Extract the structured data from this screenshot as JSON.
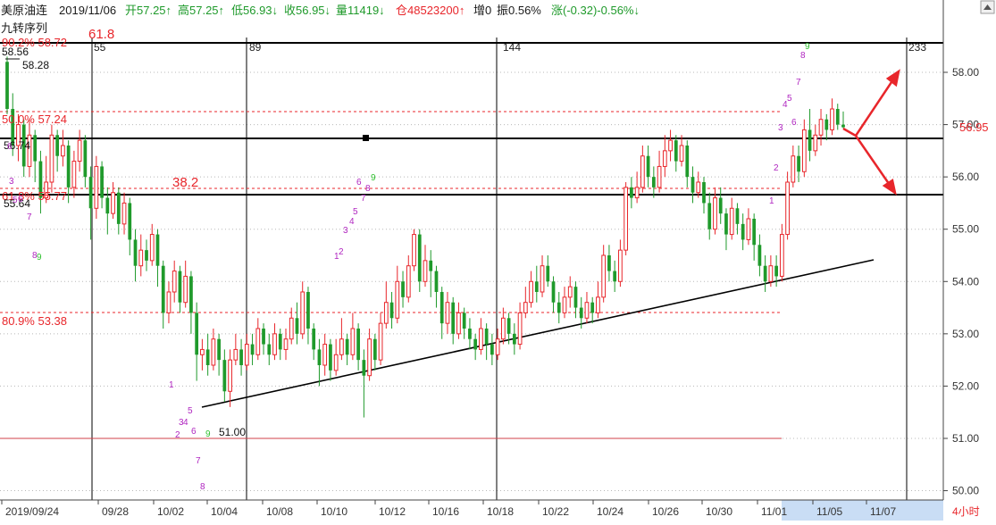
{
  "header": {
    "name": "美原油连",
    "date": "2019/11/06",
    "open_label": "开57.25↑",
    "high_label": "高57.25↑",
    "low_label": "低56.93↓",
    "close_label": "收56.95↓",
    "volume_label": "量11419↓",
    "oi_label": "仓48523200↑",
    "oi_change_label": "增0",
    "amplitude_label": "振0.56%",
    "change_label": "涨(-0.32)-0.56%↓",
    "indicator_name": "九转序列"
  },
  "colors": {
    "up": "#e8262b",
    "down": "#1f9a2b",
    "fib_line": "#e8262b",
    "td_purple": "#b026c0",
    "td_green": "#30c030",
    "time_axis_highlight": "#c9ddf5"
  },
  "price_tag": "56.95",
  "period_label": "4小时",
  "fib_time_labels": [
    "55",
    "89",
    "144",
    "233"
  ],
  "fib_ratio_labels": [
    "61.8",
    "38.2"
  ],
  "fib_levels": [
    {
      "label": "90.2% 58.72",
      "value": 58.72
    },
    {
      "label": "50.0% 57.24",
      "value": 57.24
    },
    {
      "label": "61.8% 55.77",
      "value": 55.77
    },
    {
      "label": "80.9% 53.38",
      "value": 53.38
    }
  ],
  "point_labels": [
    {
      "text": "58.56"
    },
    {
      "text": "58.28"
    },
    {
      "text": "56.74"
    },
    {
      "text": "55.64"
    },
    {
      "text": "51.00"
    }
  ],
  "chart_data": {
    "type": "candlestick",
    "title": "",
    "instrument": "美原油连",
    "interval": "4小时",
    "ylim": [
      49.8,
      58.6
    ],
    "yticks": [
      50.0,
      51.0,
      52.0,
      53.0,
      54.0,
      55.0,
      56.0,
      57.0,
      58.0
    ],
    "xticks": [
      "2019/09/24",
      "09/28",
      "10/02",
      "10/04",
      "10/08",
      "10/10",
      "10/12",
      "10/16",
      "10/18",
      "10/22",
      "10/24",
      "10/26",
      "10/30",
      "11/01",
      "11/05",
      "11/07"
    ],
    "horizontal_levels": [
      56.7,
      55.65,
      51.0
    ],
    "trendline": {
      "from": [
        51.6
      ],
      "to": [
        54.45
      ]
    },
    "last_price": 56.95,
    "key_prices": {
      "high": 58.56,
      "low": 51.0
    },
    "candles": [
      [
        58.2,
        57.3,
        58.3,
        57.2
      ],
      [
        57.3,
        56.6,
        57.6,
        56.4
      ],
      [
        56.6,
        57.0,
        57.2,
        56.3
      ],
      [
        57.0,
        56.2,
        57.1,
        56.0
      ],
      [
        56.2,
        56.8,
        57.1,
        56.0
      ],
      [
        56.8,
        56.3,
        56.9,
        55.9
      ],
      [
        56.3,
        55.6,
        56.5,
        55.3
      ],
      [
        55.6,
        55.9,
        56.4,
        55.5
      ],
      [
        55.9,
        56.8,
        57.0,
        55.7
      ],
      [
        56.8,
        56.4,
        56.9,
        56.1
      ],
      [
        56.4,
        56.6,
        56.9,
        56.2
      ],
      [
        56.6,
        55.8,
        56.7,
        55.5
      ],
      [
        55.8,
        56.3,
        56.5,
        55.6
      ],
      [
        56.3,
        56.7,
        56.9,
        56.1
      ],
      [
        56.7,
        56.0,
        56.8,
        55.8
      ],
      [
        56.0,
        55.4,
        56.2,
        54.8
      ],
      [
        55.4,
        56.2,
        56.4,
        55.2
      ],
      [
        56.2,
        55.6,
        56.3,
        55.4
      ],
      [
        55.6,
        55.3,
        55.8,
        54.9
      ],
      [
        55.3,
        55.7,
        55.9,
        55.2
      ],
      [
        55.7,
        55.1,
        55.8,
        54.9
      ],
      [
        55.1,
        55.5,
        55.7,
        54.9
      ],
      [
        55.5,
        54.8,
        55.6,
        54.5
      ],
      [
        54.8,
        54.3,
        55.0,
        54.0
      ],
      [
        54.3,
        54.6,
        54.9,
        54.1
      ],
      [
        54.6,
        54.4,
        54.8,
        54.2
      ],
      [
        54.4,
        54.9,
        55.1,
        54.3
      ],
      [
        54.9,
        54.3,
        55.0,
        53.9
      ],
      [
        54.3,
        53.4,
        54.4,
        53.1
      ],
      [
        53.4,
        53.8,
        54.0,
        53.2
      ],
      [
        53.8,
        54.2,
        54.4,
        53.6
      ],
      [
        54.2,
        53.6,
        54.3,
        53.4
      ],
      [
        53.6,
        54.1,
        54.4,
        53.5
      ],
      [
        54.1,
        53.4,
        54.2,
        53.0
      ],
      [
        53.4,
        52.6,
        53.6,
        52.1
      ],
      [
        52.6,
        52.7,
        52.9,
        52.3
      ],
      [
        52.7,
        52.4,
        53.0,
        52.2
      ],
      [
        52.4,
        52.9,
        53.1,
        52.3
      ],
      [
        52.9,
        52.5,
        53.0,
        52.2
      ],
      [
        52.5,
        51.9,
        52.7,
        51.7
      ],
      [
        51.9,
        52.5,
        52.7,
        51.6
      ],
      [
        52.5,
        52.7,
        53.0,
        52.4
      ],
      [
        52.7,
        52.4,
        52.9,
        52.2
      ],
      [
        52.4,
        52.8,
        53.0,
        52.3
      ],
      [
        52.8,
        52.6,
        53.0,
        52.4
      ],
      [
        52.6,
        53.1,
        53.3,
        52.5
      ],
      [
        53.1,
        52.8,
        53.2,
        52.6
      ],
      [
        52.8,
        52.6,
        53.0,
        52.4
      ],
      [
        52.6,
        53.0,
        53.2,
        52.5
      ],
      [
        53.0,
        52.7,
        53.1,
        52.5
      ],
      [
        52.7,
        52.9,
        53.1,
        52.5
      ],
      [
        52.9,
        53.3,
        53.5,
        52.8
      ],
      [
        53.3,
        53.0,
        53.6,
        52.8
      ],
      [
        53.0,
        53.8,
        54.0,
        52.9
      ],
      [
        53.8,
        53.1,
        53.9,
        52.8
      ],
      [
        53.1,
        52.7,
        53.2,
        52.5
      ],
      [
        52.7,
        52.4,
        52.9,
        52.0
      ],
      [
        52.4,
        52.8,
        53.0,
        52.2
      ],
      [
        52.8,
        52.3,
        52.9,
        52.1
      ],
      [
        52.3,
        52.6,
        52.9,
        52.2
      ],
      [
        52.6,
        52.9,
        53.3,
        52.5
      ],
      [
        52.9,
        52.6,
        53.0,
        52.4
      ],
      [
        52.6,
        53.1,
        53.4,
        52.5
      ],
      [
        53.1,
        52.5,
        53.2,
        52.3
      ],
      [
        52.5,
        52.2,
        52.7,
        51.4
      ],
      [
        52.2,
        52.9,
        53.1,
        52.1
      ],
      [
        52.9,
        52.5,
        53.0,
        52.3
      ],
      [
        52.5,
        53.2,
        53.4,
        52.4
      ],
      [
        53.2,
        53.6,
        54.0,
        53.1
      ],
      [
        53.6,
        53.3,
        53.8,
        53.1
      ],
      [
        53.3,
        54.0,
        54.3,
        53.2
      ],
      [
        54.0,
        53.7,
        54.2,
        53.5
      ],
      [
        53.7,
        54.3,
        54.5,
        53.6
      ],
      [
        54.3,
        54.9,
        55.0,
        54.2
      ],
      [
        54.9,
        54.0,
        55.0,
        53.8
      ],
      [
        54.0,
        54.4,
        54.7,
        53.9
      ],
      [
        54.4,
        54.2,
        54.6,
        53.7
      ],
      [
        54.2,
        53.8,
        54.3,
        53.5
      ],
      [
        53.8,
        53.2,
        53.9,
        52.9
      ],
      [
        53.2,
        53.6,
        53.8,
        53.0
      ],
      [
        53.6,
        53.0,
        53.7,
        52.8
      ],
      [
        53.0,
        53.4,
        53.6,
        52.9
      ],
      [
        53.4,
        53.1,
        53.5,
        52.9
      ],
      [
        53.1,
        52.9,
        53.3,
        52.7
      ],
      [
        52.9,
        52.7,
        53.0,
        52.5
      ],
      [
        52.7,
        53.1,
        53.3,
        52.6
      ],
      [
        53.1,
        52.8,
        53.2,
        52.5
      ],
      [
        52.8,
        52.6,
        53.0,
        52.4
      ],
      [
        52.6,
        52.9,
        53.1,
        52.5
      ],
      [
        52.9,
        53.3,
        53.5,
        52.8
      ],
      [
        53.3,
        53.0,
        53.4,
        52.8
      ],
      [
        53.0,
        52.8,
        53.2,
        52.6
      ],
      [
        52.8,
        53.4,
        53.6,
        52.7
      ],
      [
        53.4,
        53.6,
        53.9,
        53.3
      ],
      [
        53.6,
        54.0,
        54.2,
        53.5
      ],
      [
        54.0,
        53.8,
        54.3,
        53.6
      ],
      [
        53.8,
        54.3,
        54.5,
        53.7
      ],
      [
        54.3,
        54.0,
        54.5,
        53.9
      ],
      [
        54.0,
        53.6,
        54.1,
        53.4
      ],
      [
        53.6,
        53.4,
        53.8,
        53.2
      ],
      [
        53.4,
        53.7,
        53.9,
        53.3
      ],
      [
        53.7,
        53.9,
        54.1,
        53.5
      ],
      [
        53.9,
        53.5,
        54.0,
        53.3
      ],
      [
        53.5,
        53.3,
        53.7,
        53.1
      ],
      [
        53.3,
        53.6,
        53.8,
        53.2
      ],
      [
        53.6,
        53.4,
        53.7,
        53.2
      ],
      [
        53.4,
        53.7,
        54.0,
        53.3
      ],
      [
        53.7,
        54.5,
        54.7,
        53.6
      ],
      [
        54.5,
        54.2,
        54.7,
        54.0
      ],
      [
        54.2,
        54.0,
        54.4,
        53.8
      ],
      [
        54.0,
        54.6,
        54.8,
        53.9
      ],
      [
        54.6,
        55.8,
        55.9,
        54.5
      ],
      [
        55.8,
        55.6,
        56.0,
        55.4
      ],
      [
        55.6,
        55.8,
        56.1,
        55.5
      ],
      [
        55.8,
        56.4,
        56.6,
        55.7
      ],
      [
        56.4,
        56.0,
        56.6,
        55.8
      ],
      [
        56.0,
        55.8,
        56.2,
        55.6
      ],
      [
        55.8,
        56.2,
        56.5,
        55.7
      ],
      [
        56.2,
        56.5,
        56.8,
        56.0
      ],
      [
        56.5,
        56.7,
        56.9,
        56.3
      ],
      [
        56.7,
        56.3,
        56.8,
        56.1
      ],
      [
        56.3,
        56.6,
        56.8,
        56.2
      ],
      [
        56.6,
        56.0,
        56.7,
        55.8
      ],
      [
        56.0,
        55.7,
        56.2,
        55.5
      ],
      [
        55.7,
        55.9,
        56.1,
        55.6
      ],
      [
        55.9,
        55.5,
        56.0,
        55.3
      ],
      [
        55.5,
        55.0,
        55.7,
        54.8
      ],
      [
        55.0,
        55.6,
        55.8,
        54.9
      ],
      [
        55.6,
        55.3,
        55.8,
        55.1
      ],
      [
        55.3,
        54.9,
        55.4,
        54.6
      ],
      [
        54.9,
        55.4,
        55.6,
        54.8
      ],
      [
        55.4,
        55.1,
        55.5,
        54.9
      ],
      [
        55.1,
        54.8,
        55.3,
        54.6
      ],
      [
        54.8,
        55.2,
        55.4,
        54.7
      ],
      [
        55.2,
        54.7,
        55.3,
        54.4
      ],
      [
        54.7,
        54.3,
        54.9,
        54.1
      ],
      [
        54.3,
        54.0,
        54.5,
        53.8
      ],
      [
        54.0,
        54.3,
        54.5,
        53.9
      ],
      [
        54.3,
        54.1,
        54.5,
        53.9
      ],
      [
        54.1,
        54.9,
        55.1,
        54.0
      ],
      [
        54.9,
        55.9,
        56.1,
        54.8
      ],
      [
        55.9,
        56.4,
        56.6,
        55.8
      ],
      [
        56.4,
        56.1,
        56.6,
        55.9
      ],
      [
        56.1,
        56.9,
        57.1,
        56.0
      ],
      [
        56.9,
        56.5,
        57.3,
        56.3
      ],
      [
        56.5,
        56.8,
        57.0,
        56.4
      ],
      [
        56.8,
        57.1,
        57.3,
        56.6
      ],
      [
        57.1,
        56.9,
        57.2,
        56.7
      ],
      [
        56.9,
        57.3,
        57.5,
        56.8
      ],
      [
        57.3,
        57.0,
        57.4,
        56.9
      ],
      [
        57.0,
        56.95,
        57.25,
        56.93
      ]
    ]
  }
}
